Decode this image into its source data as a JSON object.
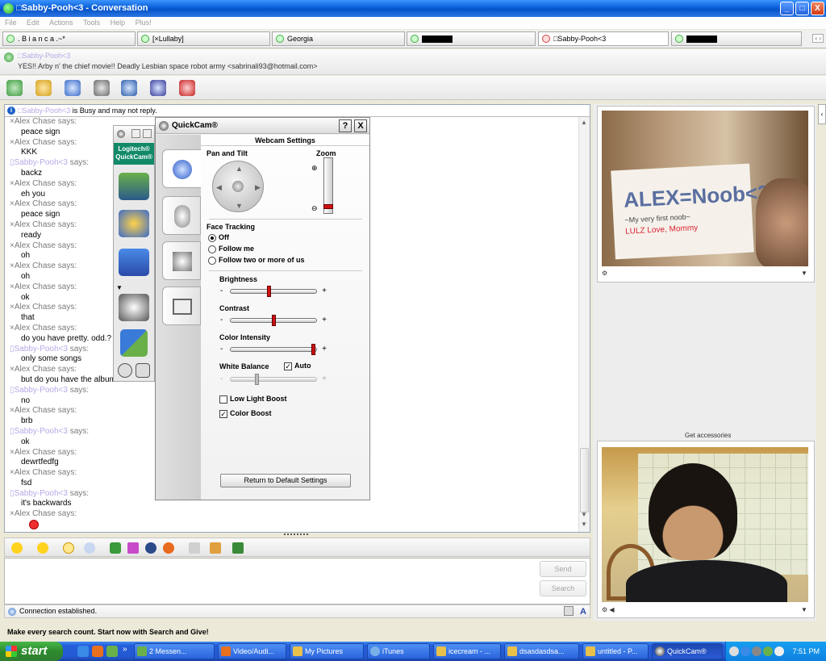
{
  "window": {
    "title": "□Sabby-Pooh<3 - Conversation",
    "buttons": {
      "min": "_",
      "max": "□",
      "close": "X"
    }
  },
  "menu": [
    "File",
    "Edit",
    "Actions",
    "Tools",
    "Help",
    "Plus!"
  ],
  "tabs": [
    {
      "label": ". B i a n c a .~*"
    },
    {
      "label": "[×Lullaby]"
    },
    {
      "label": "Georgia"
    },
    {
      "label": ""
    },
    {
      "label": "□Sabby-Pooh<3",
      "active": true
    },
    {
      "label": ""
    }
  ],
  "tab_scroll": "‹ ›",
  "contact": {
    "name": "□Sabby-Pooh<3",
    "personal_message": "YES!! Arby n' the chief movie!! Deadly Lesbian space robot army <sabrinali93@hotmail.com>"
  },
  "infobar": {
    "name": "□Sabby-Pooh<3",
    "text": " is Busy and may not reply."
  },
  "messages": [
    {
      "sender": "×Alex Chase",
      "text": "peace sign"
    },
    {
      "sender": "×Alex Chase",
      "text": "KKK"
    },
    {
      "sender": "▯Sabby-Pooh<3",
      "text": "backz",
      "sab": true
    },
    {
      "sender": "×Alex Chase",
      "text": "eh you"
    },
    {
      "sender": "×Alex Chase",
      "text": "peace sign"
    },
    {
      "sender": "×Alex Chase",
      "text": "ready"
    },
    {
      "sender": "×Alex Chase",
      "text": "oh"
    },
    {
      "sender": "×Alex Chase",
      "text": "oh"
    },
    {
      "sender": "×Alex Chase",
      "text": "ok"
    },
    {
      "sender": "×Alex Chase",
      "text": "that"
    },
    {
      "sender": "×Alex Chase",
      "text": "do you have pretty. odd.?"
    },
    {
      "sender": "▯Sabby-Pooh<3",
      "text": "only some songs",
      "sab": true
    },
    {
      "sender": "×Alex Chase",
      "text": "but do you have the album"
    },
    {
      "sender": "▯Sabby-Pooh<3",
      "text": "no",
      "sab": true
    },
    {
      "sender": "×Alex Chase",
      "text": "brb"
    },
    {
      "sender": "▯Sabby-Pooh<3",
      "text": "ok",
      "sab": true
    },
    {
      "sender": "×Alex Chase",
      "text": "dewrtfedfg"
    },
    {
      "sender": "×Alex Chase",
      "text": "fsd"
    },
    {
      "sender": "▯Sabby-Pooh<3",
      "text": "it's backwards",
      "sab": true
    },
    {
      "sender": "×Alex Chase",
      "text": ""
    }
  ],
  "says": "says:",
  "input": {
    "send": "Send",
    "search": "Search"
  },
  "status": "Connection established.",
  "ad": "Make every search count.  Start now with Search and Give!",
  "accessories": "Get accessories",
  "quickcam": {
    "title": "QuickCam®",
    "help": "?",
    "close": "X",
    "dock_logo": "Logitech® QuickCam®",
    "header": "Webcam Settings",
    "pan_tilt": "Pan and Tilt",
    "zoom": "Zoom",
    "face_tracking": "Face Tracking",
    "ft_options": [
      "Off",
      "Follow me",
      "Follow two or more of us"
    ],
    "brightness": "Brightness",
    "contrast": "Contrast",
    "color_intensity": "Color Intensity",
    "white_balance": "White Balance",
    "auto": "Auto",
    "low_light": "Low Light Boost",
    "color_boost": "Color Boost",
    "reset": "Return to Default Settings",
    "levels": {
      "brightness": 0.45,
      "contrast": 0.5,
      "color_intensity": 0.98,
      "white_balance": 0.3,
      "zoom": 0.05
    }
  },
  "webcam_sign": {
    "big": "ALEX=Noob<3",
    "small": "~My very first noob~",
    "red": "LULZ  Love, Mommy"
  },
  "taskbar": {
    "start": "start",
    "tasks": [
      "2 Messen...",
      "Video/Audi...",
      "My Pictures",
      "iTunes",
      "icecream - ...",
      "dsasdasdsa...",
      "untitled - P...",
      "QuickCam®"
    ],
    "clock": "7:51 PM"
  }
}
